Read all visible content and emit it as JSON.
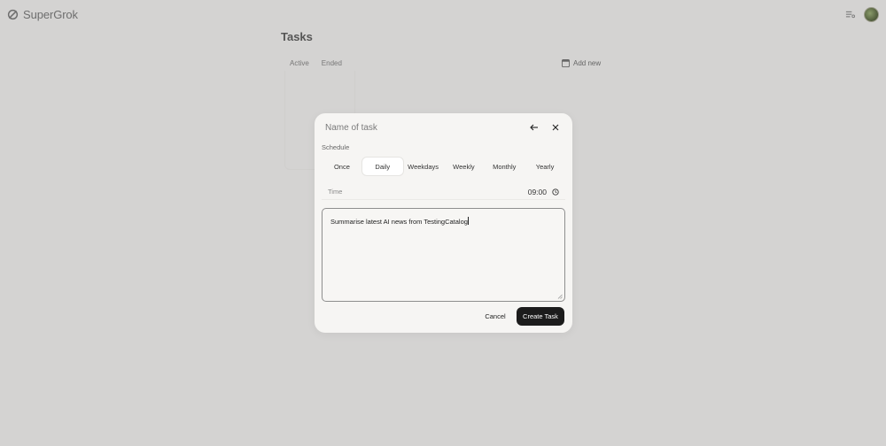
{
  "app": {
    "logo_text": "SuperGrok"
  },
  "page": {
    "title": "Tasks",
    "tabs": [
      {
        "label": "Active"
      },
      {
        "label": "Ended"
      }
    ],
    "add_new_label": "Add new"
  },
  "modal": {
    "title_placeholder": "Name of task",
    "schedule_label": "Schedule",
    "schedule_options": [
      {
        "label": "Once"
      },
      {
        "label": "Daily"
      },
      {
        "label": "Weekdays"
      },
      {
        "label": "Weekly"
      },
      {
        "label": "Monthly"
      },
      {
        "label": "Yearly"
      }
    ],
    "selected_schedule": "Daily",
    "time_label": "Time",
    "time_value": "09:00",
    "prompt_text": "Summarise latest AI news from TestingCatalog",
    "cancel_label": "Cancel",
    "create_label": "Create Task"
  },
  "colors": {
    "primary_button": "#1c1c1c",
    "backdrop": "#d4d3d2",
    "modal_bg": "#f6f5f3"
  }
}
